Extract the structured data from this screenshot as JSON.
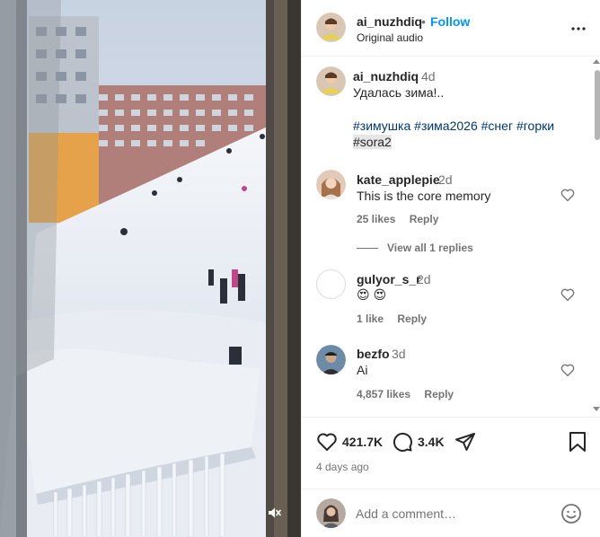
{
  "media": {
    "description_icon": "muted-speaker-icon"
  },
  "header": {
    "username": "ai_nuzhdiq",
    "separator": "•",
    "follow_label": "Follow",
    "audio_label": "Original audio",
    "more_icon": "more-options-icon"
  },
  "caption": {
    "username": "ai_nuzhdiq",
    "time": "4d",
    "text": "Удалась зима!..",
    "tags": [
      "#зимушка",
      "#зима2026",
      "#снег",
      "#горки",
      "#sora2"
    ]
  },
  "comments": [
    {
      "username": "kate_applepie",
      "time": "2d",
      "text": "This is the core memory",
      "likes": "25 likes",
      "reply": "Reply"
    },
    {
      "username": "gulyor_s_r",
      "time": "2d",
      "text": "😍 😍",
      "likes": "1 like",
      "reply": "Reply"
    },
    {
      "username": "bezfo",
      "time": "3d",
      "text": "Ai",
      "likes": "4,857 likes",
      "reply": "Reply"
    }
  ],
  "view_replies": "View all 1 replies",
  "actions": {
    "likes": "421.7K",
    "comments": "3.4K",
    "posted": "4 days ago"
  },
  "add_comment": {
    "placeholder": "Add a comment…"
  },
  "colors": {
    "accent": "#0095f6",
    "hashtag": "#00376b",
    "muted": "#737373"
  }
}
